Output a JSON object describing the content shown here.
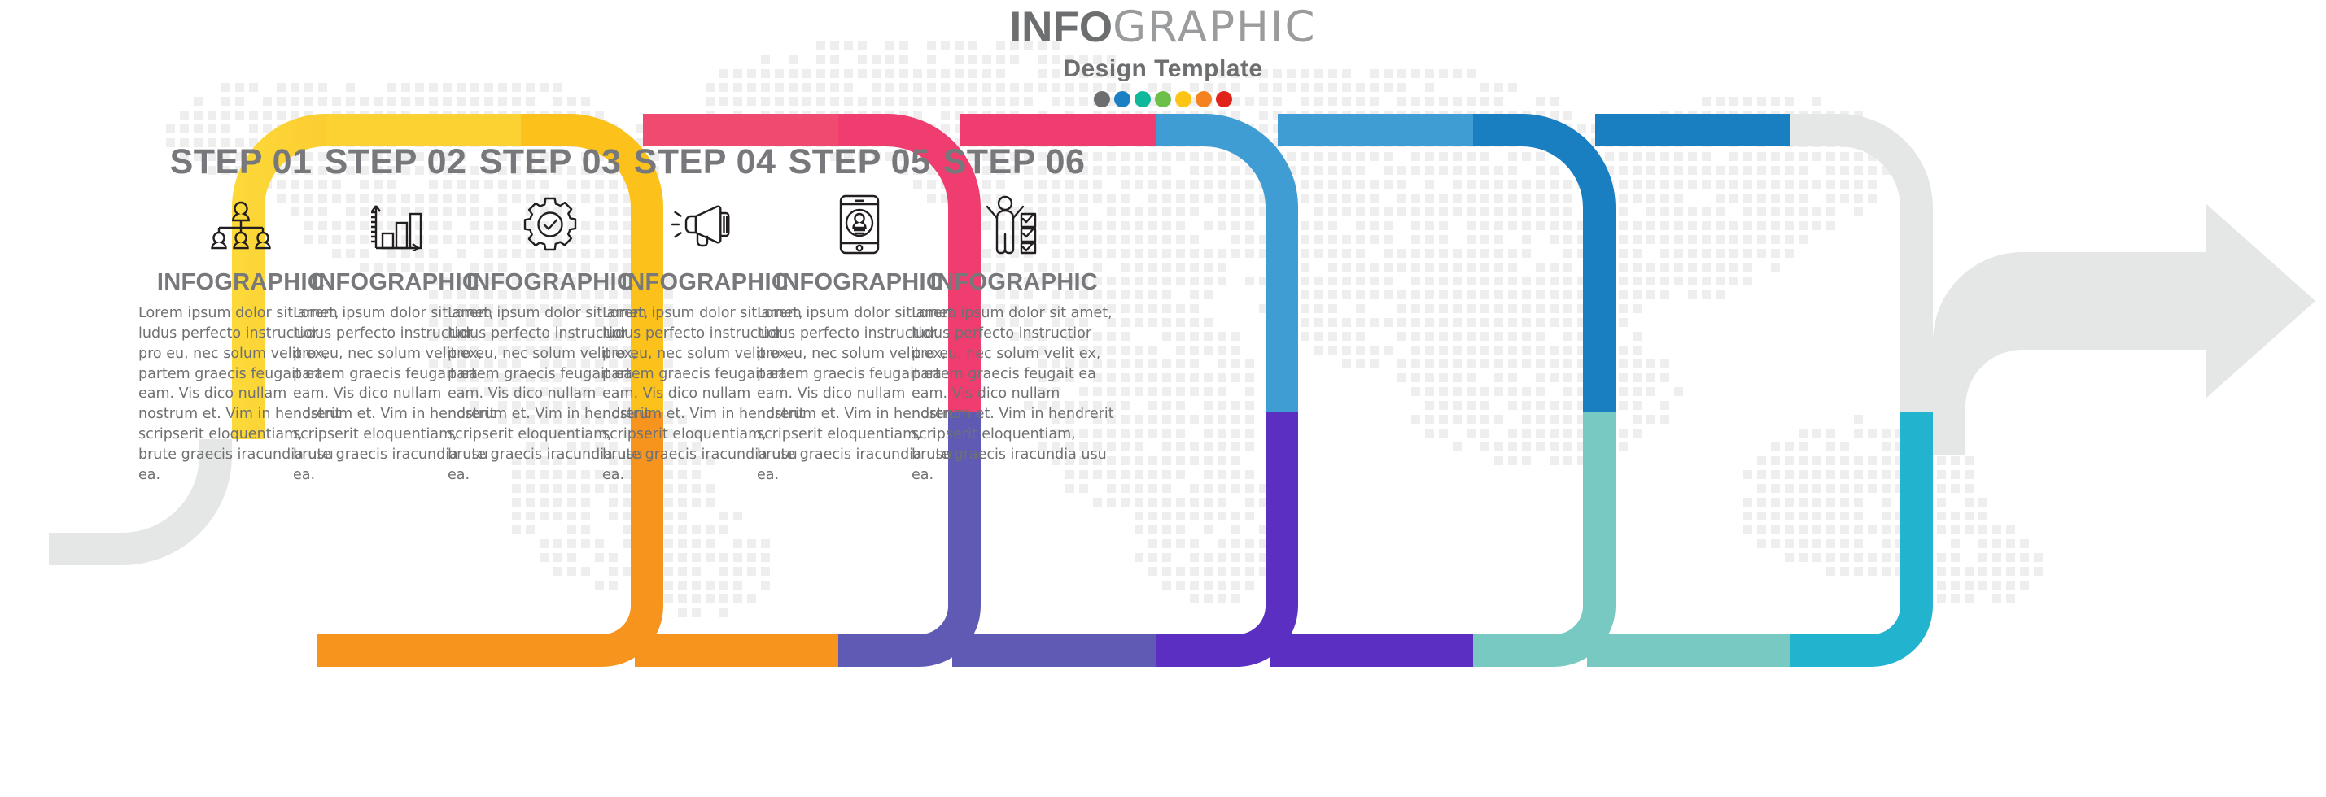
{
  "header": {
    "title_bold": "INFO",
    "title_thin": "GRAPHIC",
    "subtitle": "Design  Template",
    "dots": [
      {
        "name": "dot-gray",
        "color": "#6d6e70"
      },
      {
        "name": "dot-blue",
        "color": "#1b7fc4"
      },
      {
        "name": "dot-teal",
        "color": "#0fb89b"
      },
      {
        "name": "dot-green",
        "color": "#6cc04a"
      },
      {
        "name": "dot-yellow",
        "color": "#fcc515"
      },
      {
        "name": "dot-orange",
        "color": "#f58220"
      },
      {
        "name": "dot-red",
        "color": "#e1241b"
      }
    ]
  },
  "common": {
    "sub_head": "INFOGRAPHIC",
    "body_text": "Lorem ipsum dolor sit amet, ludus perfecto instructior pro eu, nec solum velit ex, partem graecis feugait ea eam. Vis dico nullam nostrum et. Vim in hendrerit scripserit eloquentiam, brute graecis iracundia usu ea."
  },
  "steps": [
    {
      "label": "STEP 01",
      "icon": "org-chart-icon",
      "sub_head": "INFOGRAPHIC",
      "body_text": "Lorem ipsum dolor sit amet, ludus perfecto instructior pro eu, nec solum velit ex, partem graecis feugait ea eam. Vis dico nullam nostrum et. Vim in hendrerit scripserit eloquentiam, brute graecis iracundia usu ea.",
      "band_top_color": "#fcdd3c",
      "band_bottom_color": "#fbb03b"
    },
    {
      "label": "STEP 02",
      "icon": "bar-chart-icon",
      "sub_head": "INFOGRAPHIC",
      "body_text": "Lorem ipsum dolor sit amet, ludus perfecto instructior pro eu, nec solum velit ex, partem graecis feugait ea eam. Vis dico nullam nostrum et. Vim in hendrerit scripserit eloquentiam, brute graecis iracundia usu ea.",
      "band_top_color": "#fcc21b",
      "band_bottom_color": "#f7941e"
    },
    {
      "label": "STEP 03",
      "icon": "gear-check-icon",
      "sub_head": "INFOGRAPHIC",
      "body_text": "Lorem ipsum dolor sit amet, ludus perfecto instructior pro eu, nec solum velit ex, partem graecis feugait ea eam. Vis dico nullam nostrum et. Vim in hendrerit scripserit eloquentiam, brute graecis iracundia usu ea.",
      "band_top_color": "#ee3d6e",
      "band_bottom_color": "#5f5bb5"
    },
    {
      "label": "STEP 04",
      "icon": "megaphone-icon",
      "sub_head": "INFOGRAPHIC",
      "body_text": "Lorem ipsum dolor sit amet, ludus perfecto instructior pro eu, nec solum velit ex, partem graecis feugait ea eam. Vis dico nullam nostrum et. Vim in hendrerit scripserit eloquentiam, brute graecis iracundia usu ea.",
      "band_top_color": "#3f9dd4",
      "band_bottom_color": "#5a2fc2"
    },
    {
      "label": "STEP 05",
      "icon": "mobile-user-icon",
      "sub_head": "INFOGRAPHIC",
      "body_text": "Lorem ipsum dolor sit amet, ludus perfecto instructior pro eu, nec solum velit ex, partem graecis feugait ea eam. Vis dico nullam nostrum et. Vim in hendrerit scripserit eloquentiam, brute graecis iracundia usu ea.",
      "band_top_color": "#1a7fc1",
      "band_bottom_color": "#79c9c3"
    },
    {
      "label": "STEP 06",
      "icon": "person-checklist-icon",
      "sub_head": "INFOGRAPHIC",
      "body_text": "Lorem ipsum dolor sit amet, ludus perfecto instructior pro eu, nec solum velit ex, partem graecis feugait ea eam. Vis dico nullam nostrum et. Vim in hendrerit scripserit eloquentiam, brute graecis iracundia usu ea.",
      "band_top_color": "#e5e7e7",
      "band_bottom_color": "#22b4cf"
    }
  ],
  "ribbon": {
    "tail_color": "#e5e7e7",
    "arrow_color": "#e5e7e7"
  }
}
